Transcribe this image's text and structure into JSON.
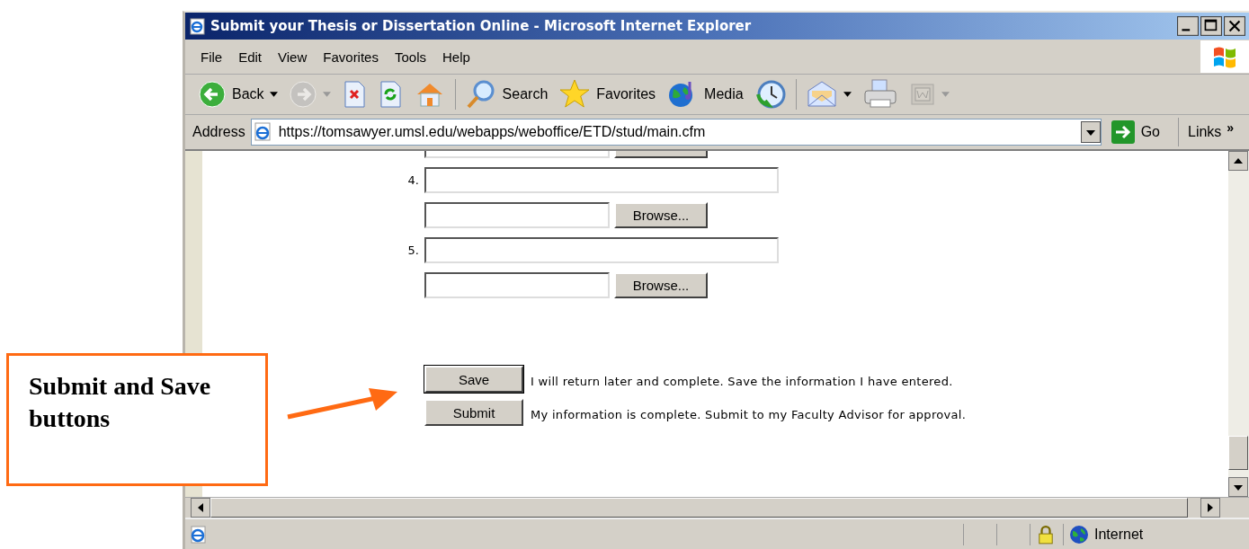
{
  "window": {
    "title": "Submit your Thesis or Dissertation Online - Microsoft Internet Explorer"
  },
  "menu": [
    "File",
    "Edit",
    "View",
    "Favorites",
    "Tools",
    "Help"
  ],
  "toolbar": [
    {
      "kind": "back",
      "label": "Back",
      "dropdown": true,
      "disabled": false
    },
    {
      "kind": "forward",
      "dropdown": true,
      "disabled": true
    },
    {
      "kind": "stop",
      "dropdown": false,
      "disabled": false
    },
    {
      "kind": "refresh",
      "dropdown": false,
      "disabled": false
    },
    {
      "kind": "home",
      "dropdown": false,
      "disabled": false
    },
    {
      "kind": "separator"
    },
    {
      "kind": "search",
      "label": "Search",
      "dropdown": false,
      "disabled": false
    },
    {
      "kind": "favorites",
      "label": "Favorites",
      "dropdown": false,
      "disabled": false
    },
    {
      "kind": "media",
      "label": "Media",
      "dropdown": false,
      "disabled": false
    },
    {
      "kind": "history",
      "dropdown": false,
      "disabled": false
    },
    {
      "kind": "separator"
    },
    {
      "kind": "mail",
      "dropdown": true,
      "disabled": false
    },
    {
      "kind": "print",
      "dropdown": false,
      "disabled": false
    },
    {
      "kind": "edit",
      "dropdown": true,
      "disabled": true
    }
  ],
  "address_bar": {
    "label": "Address",
    "url": "https://tomsawyer.umsl.edu/webapps/weboffice/ETD/stud/main.cfm",
    "go": "Go",
    "links": "Links",
    "links_more": "»"
  },
  "form": {
    "rows": [
      {
        "number": "4.",
        "browse": "Browse..."
      },
      {
        "number": "5.",
        "browse": "Browse..."
      }
    ],
    "actions": [
      {
        "button": "Save",
        "text": "I will return later and complete. Save the information I have entered.",
        "focused": true
      },
      {
        "button": "Submit",
        "text": "My information is complete. Submit to my Faculty Advisor for approval.",
        "focused": false
      }
    ]
  },
  "status_bar": {
    "zone": "Internet",
    "secure": true
  },
  "callout": {
    "text": "Submit and Save buttons"
  }
}
